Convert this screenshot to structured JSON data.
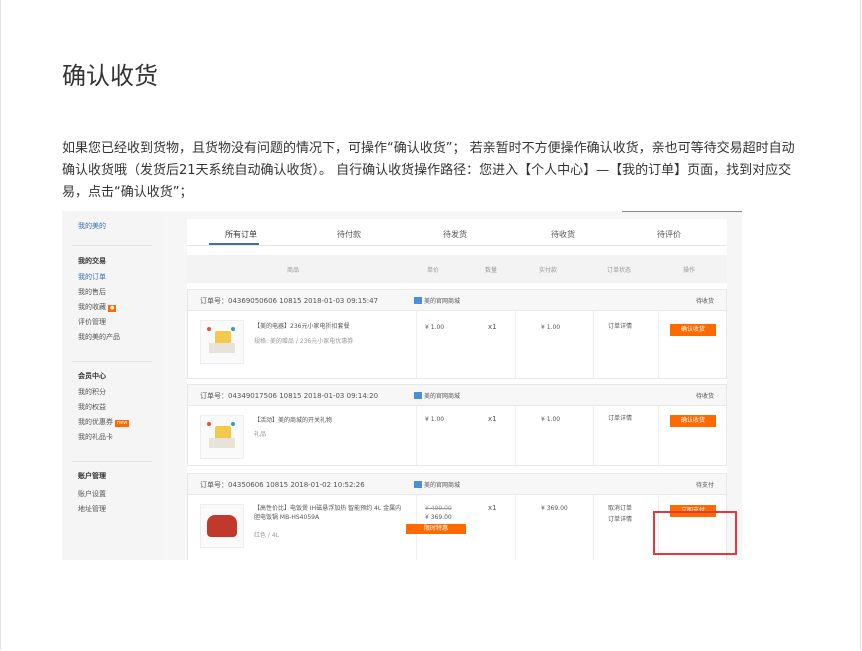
{
  "page": {
    "title": "确认收货",
    "intro": "如果您已经收到货物，且货物没有问题的情况下，可操作“确认收货”； 若亲暂时不方便操作确认收货，亲也可等待交易超时自动确认收货哦（发货后21天系统自动确认收货）。 自行确认收货操作路径：您进入【个人中心】—【我的订单】页面，找到对应交易，点击“确认收货”；"
  },
  "screenshot": {
    "sidebar": {
      "top_link": "我的美的",
      "sections": [
        {
          "title": "我的交易",
          "items": [
            "我的订单",
            "我的售后",
            "我的收藏",
            "评价管理",
            "我的美的产品"
          ]
        },
        {
          "title": "会员中心",
          "items": [
            "我的积分",
            "我的权益",
            "我的优惠券",
            "我的礼品卡"
          ]
        },
        {
          "title": "账户管理",
          "items": [
            "账户设置",
            "地址管理"
          ]
        }
      ],
      "new_badge": "new"
    },
    "tabs": [
      "所有订单",
      "待付款",
      "待发货",
      "待收货",
      "待评价"
    ],
    "columns": [
      "商品",
      "单价",
      "数量",
      "实付款",
      "订单状态",
      "操作"
    ],
    "orders": [
      {
        "number": "订单号：04369050606 10815   2018-01-03 09:15:47",
        "store": "美的官网商城",
        "status_top": "待收货",
        "name": "【美的电器】236元小家电折扣套餐",
        "sub": "规格: 美的赠品 / 236元小家电优惠券",
        "price": "¥ 1.00",
        "qty": "x1",
        "paid": "¥ 1.00",
        "status": "订单详情",
        "button": "确认收货"
      },
      {
        "number": "订单号：04349017506 10815   2018-01-03 09:14:20",
        "store": "美的官网商城",
        "status_top": "待收货",
        "name": "【活动】美的商城的开关礼物",
        "sub": "礼品",
        "price": "¥ 1.00",
        "qty": "x1",
        "paid": "¥ 1.00",
        "status": "订单详情",
        "button": "确认收货"
      },
      {
        "number": "订单号：04350606 10815   2018-01-02 10:52:26",
        "store": "美的官网商城",
        "status_top": "待支付",
        "name": "【高性价比】电饭煲 IH磁悬浮加热 智能预约 4L 金属内胆电饭锅 MB-HS4059A",
        "sub": "红色 / 4L",
        "price": "¥ 499.00",
        "price_now": "¥ 369.00",
        "promo": "限时特惠",
        "qty": "x1",
        "paid": "¥ 369.00",
        "status": "取消订单",
        "status2": "订单详情",
        "button": "立即支付"
      }
    ]
  }
}
